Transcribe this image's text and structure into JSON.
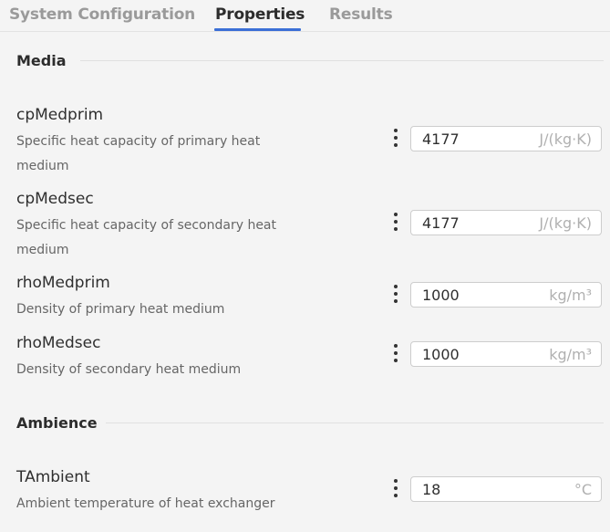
{
  "tabs": [
    {
      "label": "System Configuration",
      "active": false
    },
    {
      "label": "Properties",
      "active": true
    },
    {
      "label": "Results",
      "active": false
    }
  ],
  "accent_color": "#3b6fd6",
  "sections": {
    "media": {
      "title": "Media",
      "params": [
        {
          "name": "cpMedprim",
          "description": "Specific heat capacity of primary heat medium",
          "value": "4177",
          "unit": "J/(kg·K)"
        },
        {
          "name": "cpMedsec",
          "description": "Specific heat capacity of secondary heat medium",
          "value": "4177",
          "unit": "J/(kg·K)"
        },
        {
          "name": "rhoMedprim",
          "description": "Density of primary heat medium",
          "value": "1000",
          "unit": "kg/m³"
        },
        {
          "name": "rhoMedsec",
          "description": "Density of secondary heat medium",
          "value": "1000",
          "unit": "kg/m³"
        }
      ]
    },
    "ambience": {
      "title": "Ambience",
      "params": [
        {
          "name": "TAmbient",
          "description": "Ambient temperature of heat exchanger",
          "value": "18",
          "unit": "°C"
        }
      ]
    }
  },
  "icons": {
    "param_menu": "more-vertical-icon"
  }
}
